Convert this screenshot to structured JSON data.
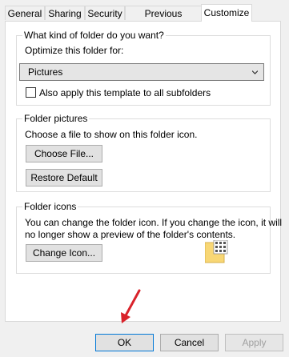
{
  "tabs": [
    "General",
    "Sharing",
    "Security",
    "Previous Versions",
    "Customize"
  ],
  "active_tab": "Customize",
  "folder_type": {
    "title": "What kind of folder do you want?",
    "optimize_label": "Optimize this folder for:",
    "selected": "Pictures",
    "apply_label": "Also apply this template to all subfolders",
    "apply_checked": false
  },
  "folder_pictures": {
    "title": "Folder pictures",
    "description": "Choose a file to show on this folder icon.",
    "choose_file": "Choose File...",
    "restore_default": "Restore Default"
  },
  "folder_icons": {
    "title": "Folder icons",
    "description_line1": "You can change the folder icon. If you change the icon, it will",
    "description_line2": "no longer show a preview of the folder's contents.",
    "change_icon": "Change Icon..."
  },
  "footer": {
    "ok": "OK",
    "cancel": "Cancel",
    "apply": "Apply"
  },
  "colors": {
    "focus": "#0078d7",
    "annotation_arrow": "#d9232b",
    "folder": "#f8d775"
  }
}
